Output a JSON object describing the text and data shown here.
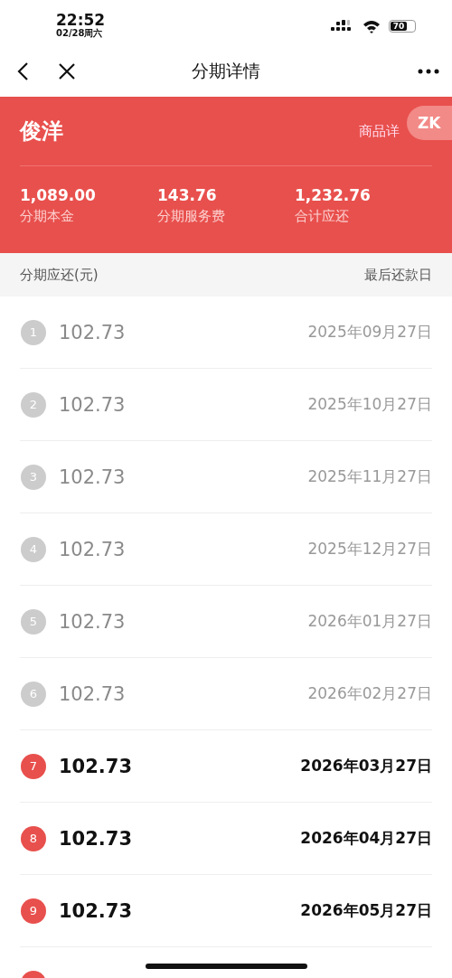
{
  "status_bar": {
    "time": "22:52",
    "date": "02/28周六",
    "battery": "70"
  },
  "nav": {
    "title": "分期详情"
  },
  "summary": {
    "name": "俊洋",
    "link": "商品详",
    "badge": "ZK",
    "figures": [
      {
        "value": "1,089.00",
        "label": "分期本金"
      },
      {
        "value": "143.76",
        "label": "分期服务费"
      },
      {
        "value": "1,232.76",
        "label": "合计应还"
      }
    ]
  },
  "table": {
    "columns": [
      "分期应还(元)",
      "最后还款日"
    ],
    "rows": [
      {
        "index": "1",
        "amount": "102.73",
        "due": "2025年09月27日",
        "paid": true
      },
      {
        "index": "2",
        "amount": "102.73",
        "due": "2025年10月27日",
        "paid": true
      },
      {
        "index": "3",
        "amount": "102.73",
        "due": "2025年11月27日",
        "paid": true
      },
      {
        "index": "4",
        "amount": "102.73",
        "due": "2025年12月27日",
        "paid": true
      },
      {
        "index": "5",
        "amount": "102.73",
        "due": "2026年01月27日",
        "paid": true
      },
      {
        "index": "6",
        "amount": "102.73",
        "due": "2026年02月27日",
        "paid": true
      },
      {
        "index": "7",
        "amount": "102.73",
        "due": "2026年03月27日",
        "paid": false
      },
      {
        "index": "8",
        "amount": "102.73",
        "due": "2026年04月27日",
        "paid": false
      },
      {
        "index": "9",
        "amount": "102.73",
        "due": "2026年05月27日",
        "paid": false
      },
      {
        "paid": false
      }
    ]
  }
}
